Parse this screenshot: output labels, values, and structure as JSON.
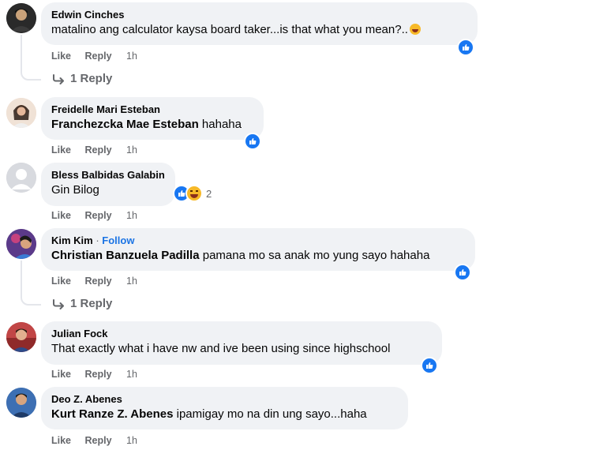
{
  "actions": {
    "like": "Like",
    "reply": "Reply"
  },
  "comments": [
    {
      "name": "Edwin Cinches",
      "mention": "",
      "text": "matalino ang calculator kaysa board taker...is that what you mean?..",
      "time": "1h",
      "reactions": [
        "like"
      ],
      "reaction_count": "",
      "replies": "1 Reply"
    },
    {
      "name": "Freidelle Mari Esteban",
      "mention": "Franchezcka Mae Esteban",
      "text": " hahaha",
      "time": "1h",
      "reactions": [
        "like"
      ],
      "reaction_count": "",
      "replies": ""
    },
    {
      "name": "Bless Balbidas Galabin",
      "mention": "",
      "text": "Gin Bilog",
      "time": "1h",
      "reactions": [
        "like",
        "haha"
      ],
      "reaction_count": "2",
      "replies": ""
    },
    {
      "name": "Kim Kim",
      "follow": "Follow",
      "mention": "Christian Banzuela Padilla",
      "text": " pamana mo sa anak mo yung sayo hahaha",
      "time": "1h",
      "reactions": [
        "like"
      ],
      "reaction_count": "",
      "replies": "1 Reply"
    },
    {
      "name": "Julian Fock",
      "mention": "",
      "text": "That exactly what i have nw and ive been using since highschool",
      "time": "1h",
      "reactions": [
        "like"
      ],
      "reaction_count": "",
      "replies": ""
    },
    {
      "name": "Deo Z. Abenes",
      "mention": "Kurt Ranze Z. Abenes",
      "text": " ipamigay mo na din ung sayo...haha",
      "time": "1h",
      "reactions": [],
      "reaction_count": "",
      "replies": ""
    }
  ],
  "colors": {
    "like_blue": "#1877f2",
    "bubble": "#f0f2f5",
    "meta_gray": "#65676b",
    "follow_blue": "#1b74e4"
  },
  "icons": {
    "like": "thumbs-up-icon",
    "haha": "laughing-emoji-icon",
    "reply": "reply-arrow-icon"
  }
}
